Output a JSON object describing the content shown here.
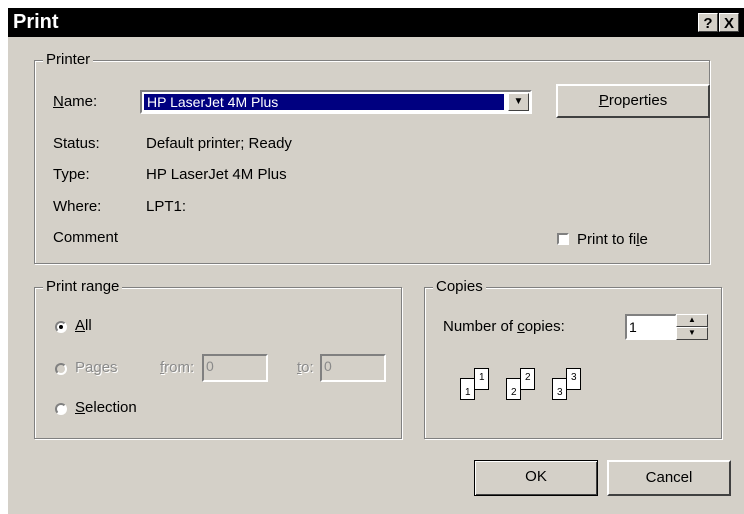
{
  "window": {
    "title": "Print",
    "help_glyph": "?",
    "close_glyph": "X"
  },
  "printer": {
    "legend": "Printer",
    "name_label": "Name:",
    "name_value": "HP LaserJet 4M Plus",
    "properties_button": "Properties",
    "status_label": "Status:",
    "status_value": "Default printer; Ready",
    "type_label": "Type:",
    "type_value": "HP LaserJet 4M Plus",
    "where_label": "Where:",
    "where_value": "LPT1:",
    "comment_label": "Comment",
    "print_to_file_label": "Print to file",
    "print_to_file_checked": false
  },
  "print_range": {
    "legend": "Print range",
    "all_label": "All",
    "pages_label": "Pages",
    "from_label": "from:",
    "from_value": "0",
    "to_label": "to:",
    "to_value": "0",
    "selection_label": "Selection",
    "selected": "All"
  },
  "copies": {
    "legend": "Copies",
    "number_label": "Number of copies:",
    "number_value": "1",
    "collate_pages": [
      "1",
      "1",
      "2",
      "2",
      "3",
      "3"
    ]
  },
  "buttons": {
    "ok": "OK",
    "cancel": "Cancel"
  }
}
